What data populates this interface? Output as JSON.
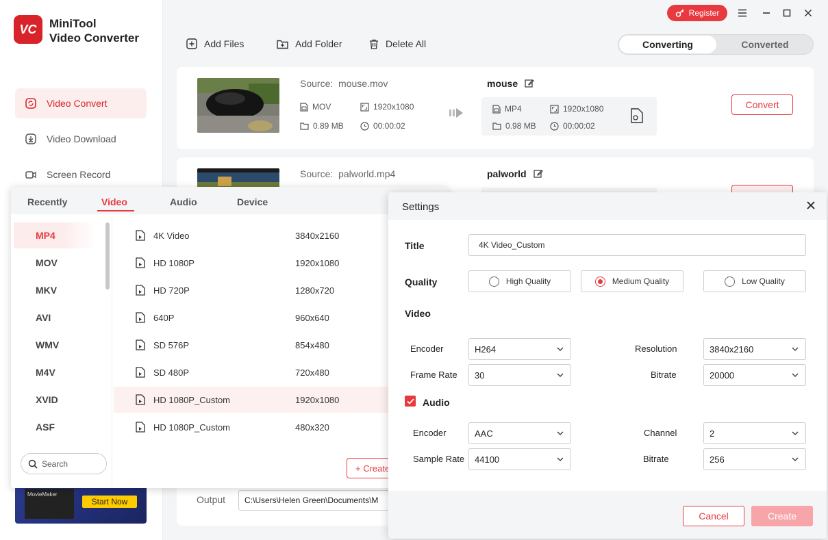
{
  "app": {
    "name_line1": "MiniTool",
    "name_line2": "Video Converter",
    "logo_text": "VC"
  },
  "sidebar": {
    "items": [
      {
        "label": "Video Convert",
        "icon": "convert-icon",
        "active": true
      },
      {
        "label": "Video Download",
        "icon": "download-icon",
        "active": false
      },
      {
        "label": "Screen Record",
        "icon": "record-icon",
        "active": false
      }
    ],
    "promo": {
      "label": "MovieMaker",
      "button": "Start Now"
    }
  },
  "titlebar": {
    "register": "Register"
  },
  "toolbar": {
    "add_files": "Add Files",
    "add_folder": "Add Folder",
    "delete_all": "Delete All",
    "tabs": [
      "Converting",
      "Converted"
    ],
    "active_tab": "Converting"
  },
  "tasks": [
    {
      "source_prefix": "Source:",
      "source_name": "mouse.mov",
      "src_format": "MOV",
      "src_resolution": "1920x1080",
      "src_size": "0.89 MB",
      "src_duration": "00:00:02",
      "out_name": "mouse",
      "out_format": "MP4",
      "out_resolution": "1920x1080",
      "out_size": "0.98 MB",
      "out_duration": "00:00:02",
      "convert_label": "Convert"
    },
    {
      "source_prefix": "Source:",
      "source_name": "palworld.mp4",
      "out_name": "palworld"
    }
  ],
  "output": {
    "label": "Output",
    "path": "C:\\Users\\Helen Green\\Documents\\M"
  },
  "format_panel": {
    "tabs": [
      "Recently",
      "Video",
      "Audio",
      "Device"
    ],
    "active_tab": "Video",
    "formats": [
      "MP4",
      "MOV",
      "MKV",
      "AVI",
      "WMV",
      "M4V",
      "XVID",
      "ASF"
    ],
    "active_format": "MP4",
    "presets": [
      {
        "name": "4K Video",
        "resolution": "3840x2160"
      },
      {
        "name": "HD 1080P",
        "resolution": "1920x1080"
      },
      {
        "name": "HD 720P",
        "resolution": "1280x720"
      },
      {
        "name": "640P",
        "resolution": "960x640"
      },
      {
        "name": "SD 576P",
        "resolution": "854x480"
      },
      {
        "name": "SD 480P",
        "resolution": "720x480"
      },
      {
        "name": "HD 1080P_Custom",
        "resolution": "1920x1080"
      },
      {
        "name": "HD 1080P_Custom",
        "resolution": "480x320"
      }
    ],
    "active_preset_index": 6,
    "search_placeholder": "Search",
    "create_custom": "+ Create Custom"
  },
  "settings": {
    "title": "Settings",
    "title_label": "Title",
    "title_value": "4K Video_Custom",
    "quality_label": "Quality",
    "quality_options": [
      "High Quality",
      "Medium Quality",
      "Low Quality"
    ],
    "quality_selected": "Medium Quality",
    "video_section": "Video",
    "video": {
      "encoder_label": "Encoder",
      "encoder": "H264",
      "resolution_label": "Resolution",
      "resolution": "3840x2160",
      "frame_rate_label": "Frame Rate",
      "frame_rate": "30",
      "bitrate_label": "Bitrate",
      "bitrate": "20000"
    },
    "audio_section": "Audio",
    "audio_enabled": true,
    "audio": {
      "encoder_label": "Encoder",
      "encoder": "AAC",
      "channel_label": "Channel",
      "channel": "2",
      "sample_rate_label": "Sample Rate",
      "sample_rate": "44100",
      "bitrate_label": "Bitrate",
      "bitrate": "256"
    },
    "cancel": "Cancel",
    "create": "Create"
  },
  "colors": {
    "accent": "#e8393f",
    "logo": "#d8232a"
  }
}
